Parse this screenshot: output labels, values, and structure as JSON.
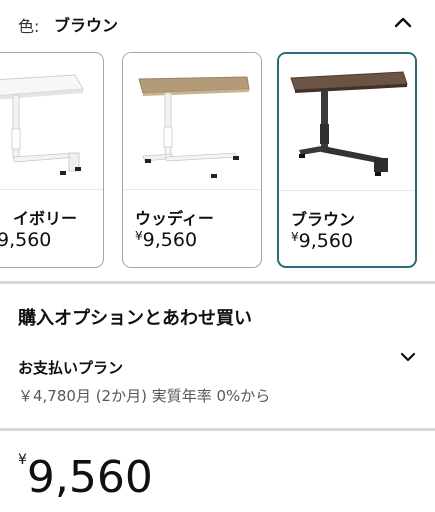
{
  "color_selector": {
    "label": "色:",
    "selected_value": "ブラウン"
  },
  "swatches": [
    {
      "name": "ホワイト・アイボリー",
      "visible_name": "イボリー",
      "currency": "¥",
      "price": "9,560",
      "visible_price": "9,560",
      "top_color": "#f4f4f4",
      "frame_color": "#f2f2f2"
    },
    {
      "name": "ウッディー",
      "currency": "¥",
      "price": "9,560",
      "top_color": "#b39a78",
      "frame_color": "#f2f2f2"
    },
    {
      "name": "ブラウン",
      "currency": "¥",
      "price": "9,560",
      "top_color": "#6b5443",
      "frame_color": "#3a3a3a",
      "selected": true
    }
  ],
  "purchase_options": {
    "title": "購入オプションとあわせ買い",
    "plan_title": "お支払いプラン",
    "plan_detail": "￥4,780月 (2か月) 実質年率 0%から"
  },
  "price": {
    "currency": "¥",
    "amount": "9,560"
  },
  "colors": {
    "selected_border": "#2a6c7c",
    "divider": "#d5d9d9"
  }
}
